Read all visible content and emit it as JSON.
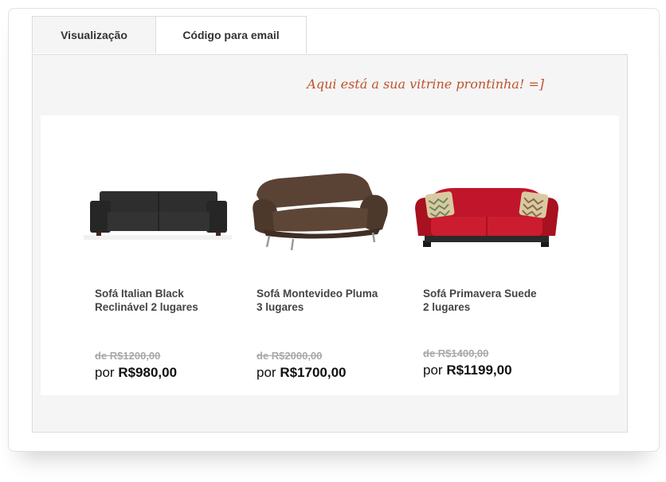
{
  "tabs": {
    "preview": "Visualização",
    "code": "Código para email"
  },
  "tagline": "Aqui está a sua vitrine prontinha!  =]",
  "colors": {
    "accent": "#c0522e",
    "panel_bg": "#f4f5f4",
    "sofa_black": "#2b2b2b",
    "sofa_brown": "#5a4234",
    "sofa_red": "#c0152a"
  },
  "products": [
    {
      "name": "Sofá Italian Black\nReclinável 2 lugares",
      "old_price": "de R$1200,00",
      "price_prefix": "por",
      "price": "R$980,00"
    },
    {
      "name": "Sofá Montevideo Pluma\n3 lugares",
      "old_price": "de R$2000,00",
      "price_prefix": "por",
      "price": "R$1700,00"
    },
    {
      "name": "Sofá Primavera Suede\n2 lugares",
      "old_price": "de R$1400,00",
      "price_prefix": "por",
      "price": "R$1199,00"
    }
  ]
}
